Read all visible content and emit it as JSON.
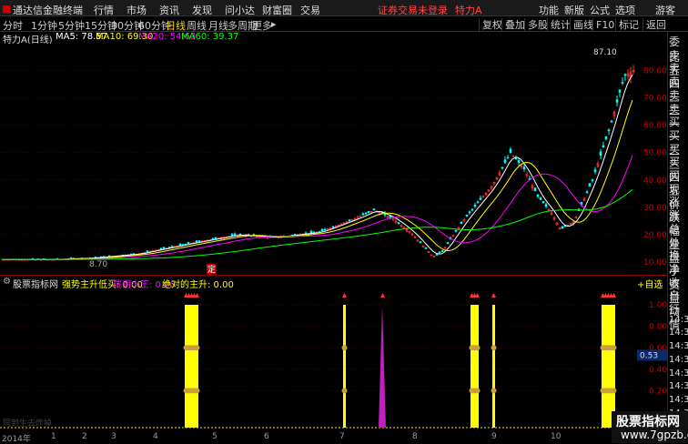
{
  "menu": {
    "app_name": "通达信金融终端",
    "items": [
      "行情",
      "市场",
      "资讯",
      "发现",
      "问小达",
      "财富圈",
      "交易"
    ],
    "status": "证券交易未登录",
    "stock": "特力A",
    "right_items": [
      "功能",
      "新版",
      "公式",
      "选项",
      "游客"
    ]
  },
  "periods": {
    "items": [
      "分时",
      "1分钟",
      "5分钟",
      "15分钟",
      "30分钟",
      "60分钟",
      "日线",
      "周线",
      "月线",
      "多周期",
      "更多"
    ],
    "selected": "日线"
  },
  "toolbar": [
    "复权",
    "叠加",
    "多股",
    "统计",
    "画线",
    "F10",
    "标记",
    "返回"
  ],
  "indicator_main": {
    "title": "特力A(日线)",
    "ma5": "MA5: 78.57",
    "ma10": "MA10: 69.30",
    "ma20": "MA20: 54.63",
    "ma60": "MA60: 39.37"
  },
  "indicator_sub": {
    "title": "股票指标网",
    "l1": "强势主升低买: 0.00",
    "l2": "瑞丽小王: 0.00",
    "l3": "绝对的主升: 0.00",
    "self_select": "+自选"
  },
  "price_axis": [
    "80.00",
    "70.00",
    "60.00",
    "50.00",
    "40.00",
    "30.00",
    "20.00",
    "10.00"
  ],
  "sub_axis": [
    "1.00",
    "0.80",
    "0.60",
    "0.40",
    "0.20"
  ],
  "sub_axis_marker": "0.53",
  "labels": {
    "high": "87.10",
    "low": "8.70",
    "ding": "定",
    "watermark": "同到生去炸掉"
  },
  "xaxis": [
    "2014年",
    "1",
    "2",
    "3",
    "4",
    "5",
    "6",
    "7",
    "8",
    "9",
    "10"
  ],
  "right_panel": [
    "委比",
    "卖五",
    "卖四",
    "卖三",
    "卖二",
    "卖一",
    "买一",
    "买二",
    "买三",
    "买四",
    "买五",
    "现价",
    "涨跌",
    "涨幅",
    "总量",
    "外盘",
    "换手",
    "净资",
    "收益",
    "自动",
    "行情",
    "14:35",
    "14:35",
    "14:35",
    "14:35",
    "14:35",
    "14:35",
    "14:35",
    "14:35",
    "14:35"
  ],
  "logo": {
    "line1": "股票指标网",
    "line2": "www.7gpzb.com"
  },
  "colors": {
    "up": "#ff3333",
    "down": "#00ffff",
    "ma5": "#ffffff",
    "ma10": "#ffff00",
    "ma20": "#ff00ff",
    "ma60": "#00ff00",
    "signal": "#ffff00",
    "signal2": "#ff00ff"
  }
}
